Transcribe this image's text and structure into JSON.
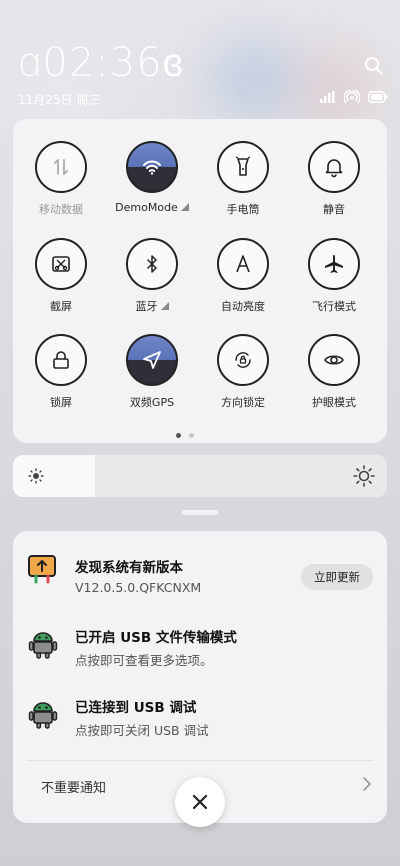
{
  "status": {
    "time": "ɑ02:36ɞ",
    "date": "11月25日 周三",
    "icons": [
      "signal-icon",
      "hotspot-icon",
      "battery-icon"
    ]
  },
  "tiles": [
    {
      "label": "移动数据",
      "icon": "mobile-data-icon",
      "active": false,
      "dim": true,
      "expand": false
    },
    {
      "label": "DemoMode",
      "icon": "wifi-icon",
      "active": true,
      "dim": false,
      "expand": true
    },
    {
      "label": "手电筒",
      "icon": "flashlight-icon",
      "active": false,
      "dim": false,
      "expand": false
    },
    {
      "label": "静音",
      "icon": "bell-icon",
      "active": false,
      "dim": false,
      "expand": false
    },
    {
      "label": "截屏",
      "icon": "screenshot-icon",
      "active": false,
      "dim": false,
      "expand": false
    },
    {
      "label": "蓝牙",
      "icon": "bluetooth-icon",
      "active": false,
      "dim": false,
      "expand": true
    },
    {
      "label": "自动亮度",
      "icon": "auto-brightness-icon",
      "active": false,
      "dim": false,
      "expand": false
    },
    {
      "label": "飞行模式",
      "icon": "airplane-icon",
      "active": false,
      "dim": false,
      "expand": false
    },
    {
      "label": "锁屏",
      "icon": "lock-icon",
      "active": false,
      "dim": false,
      "expand": false
    },
    {
      "label": "双频GPS",
      "icon": "gps-icon",
      "active": true,
      "dim": false,
      "expand": false
    },
    {
      "label": "方向锁定",
      "icon": "rotation-lock-icon",
      "active": false,
      "dim": false,
      "expand": false
    },
    {
      "label": "护眼模式",
      "icon": "eye-icon",
      "active": false,
      "dim": false,
      "expand": false
    }
  ],
  "pages": {
    "count": 2,
    "current": 1
  },
  "brightness": {
    "level": 0.22
  },
  "notifications": [
    {
      "title": "发现系统有新版本",
      "subtitle": "V12.0.5.0.QFKCNXM",
      "action": "立即更新",
      "icon": "update-icon"
    },
    {
      "title": "已开启 USB 文件传输模式",
      "subtitle": "点按即可查看更多选项。",
      "icon": "android-icon"
    },
    {
      "title": "已连接到 USB 调试",
      "subtitle": "点按即可关闭 USB 调试",
      "icon": "android-icon"
    }
  ],
  "footer": {
    "muted_label": "不重要通知"
  },
  "colors": {
    "accent": "#5a72b8",
    "panel": "#f3f3f5"
  }
}
